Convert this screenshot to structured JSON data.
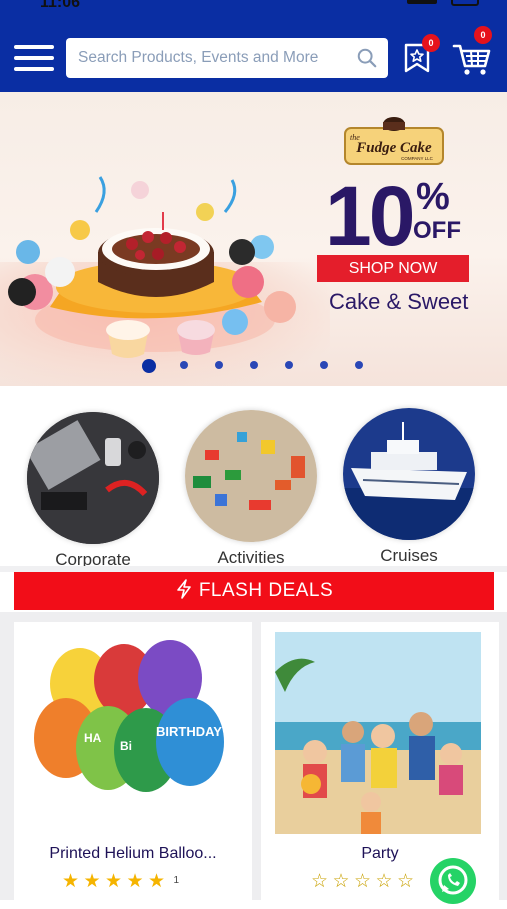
{
  "status": {
    "time": "11:06"
  },
  "header": {
    "search_placeholder": "Search Products, Events and More",
    "wishlist_count": "0",
    "cart_count": "0"
  },
  "banner": {
    "brand_small": "the",
    "brand": "Fudge Cake",
    "brand_sub": "COMPANY LLC",
    "discount_number": "10",
    "discount_symbol": "%",
    "discount_word": "OFF",
    "cta": "SHOP NOW",
    "caption": "Cake & Sweet",
    "slides": 7,
    "active_slide": 1
  },
  "categories": [
    {
      "label": "Corporate"
    },
    {
      "label": "Activities"
    },
    {
      "label": "Cruises"
    }
  ],
  "flash": {
    "label": "FLASH DEALS"
  },
  "products": [
    {
      "title": "Printed Helium Balloo...",
      "rating": 5,
      "rating_count": "1"
    },
    {
      "title": "Party",
      "rating": 0
    }
  ],
  "colors": {
    "brand_blue": "#0a2ea3",
    "flash_red": "#f20d18",
    "banner_purple": "#2a1866",
    "star_yellow": "#f5b400"
  }
}
